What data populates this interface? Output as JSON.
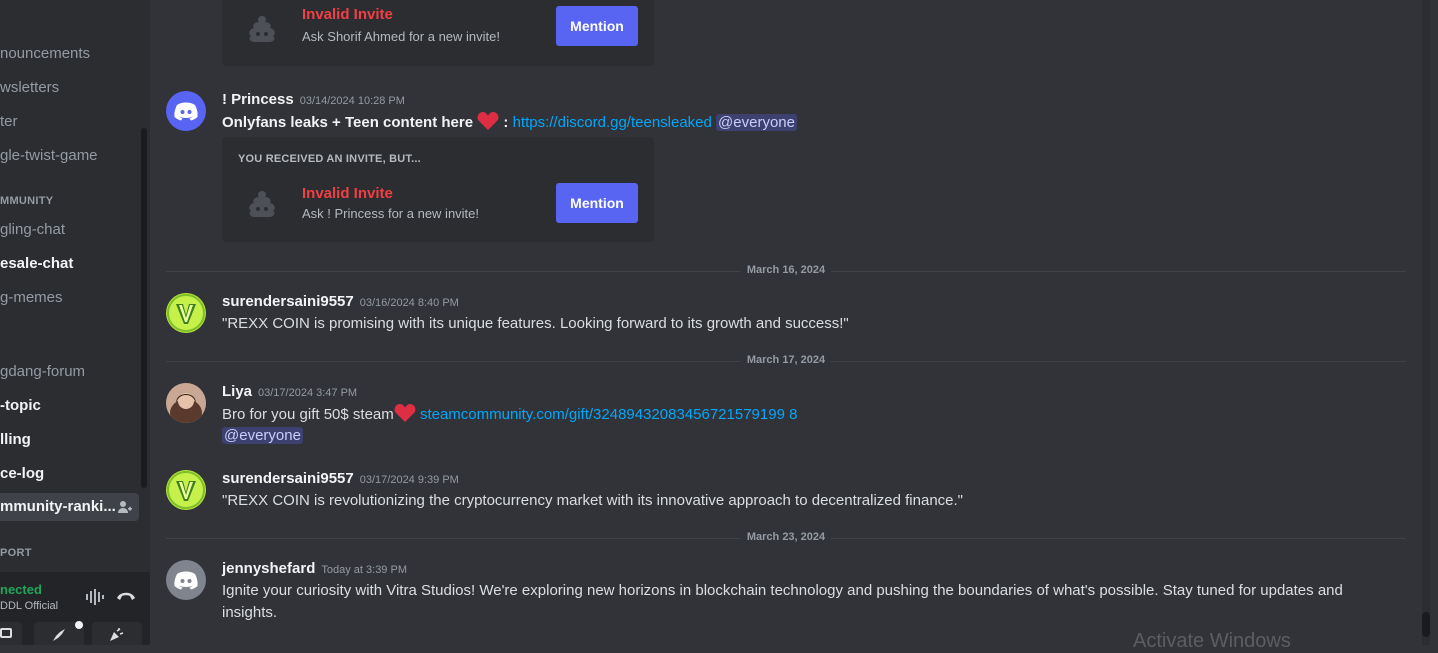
{
  "sidebar": {
    "channels": [
      {
        "label": "nouncements",
        "state": "muted"
      },
      {
        "label": "wsletters",
        "state": "muted"
      },
      {
        "label": "ter",
        "state": "muted"
      },
      {
        "label": "gle-twist-game",
        "state": "muted"
      },
      {
        "label": "gling-chat",
        "state": "muted"
      },
      {
        "label": "esale-chat",
        "state": "unread"
      },
      {
        "label": "g-memes",
        "state": "muted"
      },
      {
        "label": "gdang-forum",
        "state": "muted"
      },
      {
        "label": "-topic",
        "state": "unread"
      },
      {
        "label": "lling",
        "state": "unread"
      },
      {
        "label": "ce-log",
        "state": "unread"
      },
      {
        "label": "mmunity-ranki...",
        "state": "active"
      }
    ],
    "categories": [
      "MMUNITY",
      "PORT"
    ],
    "voice": {
      "status": "nected",
      "channel": "DDL Official"
    }
  },
  "messages": {
    "m0": {
      "invite_title": "Invalid Invite",
      "invite_sub": "Ask Shorif Ahmed for a new invite!",
      "mention_label": "Mention"
    },
    "m1": {
      "author": "! Princess",
      "time": "03/14/2024 10:28 PM",
      "text_bold": "Onlyfans leaks + Teen content here",
      "text_colon": " :",
      "link": "https://discord.gg/teensleaked",
      "mention": "@everyone",
      "invite_header": "YOU RECEIVED AN INVITE, BUT...",
      "invite_title": "Invalid Invite",
      "invite_sub": "Ask ! Princess for a new invite!",
      "mention_label": "Mention"
    },
    "divider1": "March 16, 2024",
    "m2": {
      "author": "surendersaini9557",
      "time": "03/16/2024 8:40 PM",
      "text": "\"REXX COIN is promising with its unique features. Looking forward to its growth and success!\""
    },
    "divider2": "March 17, 2024",
    "m3": {
      "author": "Liya",
      "time": "03/17/2024 3:47 PM",
      "text": "Bro for you gift 50$ steam",
      "link": "steamcommunity.com/gift/32489432083456721579199 8",
      "mention": "@everyone"
    },
    "m4": {
      "author": "surendersaini9557",
      "time": "03/17/2024 9:39 PM",
      "text": "\"REXX COIN is revolutionizing the cryptocurrency market with its innovative approach to decentralized finance.\""
    },
    "divider3": "March 23, 2024",
    "m5": {
      "author": "jennyshefard",
      "time": "Today at 3:39 PM",
      "text": "Ignite your curiosity with Vitra Studios! We're exploring new horizons in blockchain technology and pushing the boundaries of what's possible. Stay tuned for updates and insights."
    }
  },
  "watermark": "Activate Windows",
  "colors": {
    "accent": "#5865f2",
    "link": "#00a8fc",
    "error": "#f23f43",
    "connected": "#23a559"
  }
}
